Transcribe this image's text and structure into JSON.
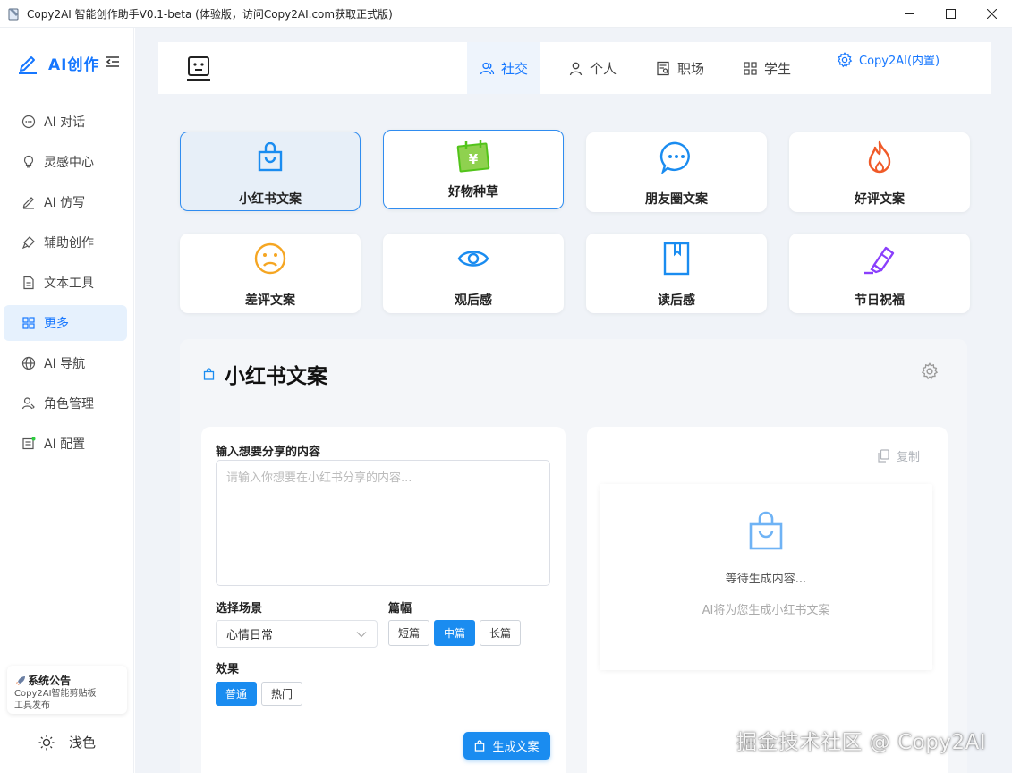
{
  "window": {
    "title": "Copy2AI 智能创作助手V0.1-beta (体验版，访问Copy2AI.com获取正式版)"
  },
  "sidebar": {
    "brand": "AI创作",
    "items": [
      {
        "label": "AI 对话",
        "icon": "chat-icon"
      },
      {
        "label": "灵感中心",
        "icon": "lightbulb-icon"
      },
      {
        "label": "AI 仿写",
        "icon": "pen-icon"
      },
      {
        "label": "辅助创作",
        "icon": "brush-icon"
      },
      {
        "label": "文本工具",
        "icon": "document-icon"
      },
      {
        "label": "更多",
        "icon": "grid-icon",
        "active": true
      },
      {
        "label": "AI 导航",
        "icon": "globe-icon"
      },
      {
        "label": "角色管理",
        "icon": "user-role-icon"
      },
      {
        "label": "AI 配置",
        "icon": "config-icon"
      }
    ],
    "notice": {
      "title": "系统公告",
      "body": "Copy2AI智能剪贴板工具发布"
    },
    "theme_label": "浅色"
  },
  "topnav": {
    "tabs": [
      {
        "label": "社交",
        "icon": "social-icon",
        "active": true
      },
      {
        "label": "个人",
        "icon": "person-icon"
      },
      {
        "label": "职场",
        "icon": "resume-icon"
      },
      {
        "label": "学生",
        "icon": "grid-icon"
      }
    ],
    "settings_label": "Copy2AI(内置)"
  },
  "categories": [
    {
      "label": "小红书文案",
      "icon": "shopping-bag-icon",
      "color": "#1a8cf0",
      "state": "selected"
    },
    {
      "label": "好物种草",
      "icon": "calendar-yen-icon",
      "color": "#52c41a",
      "state": "outlined"
    },
    {
      "label": "朋友圈文案",
      "icon": "chat-bubble-icon",
      "color": "#1a8cf0",
      "state": "normal"
    },
    {
      "label": "好评文案",
      "icon": "flame-icon",
      "color": "#f05a28",
      "state": "normal"
    },
    {
      "label": "差评文案",
      "icon": "sad-face-icon",
      "color": "#f5a623",
      "state": "normal"
    },
    {
      "label": "观后感",
      "icon": "eye-icon",
      "color": "#1a8cf0",
      "state": "normal"
    },
    {
      "label": "读后感",
      "icon": "book-icon",
      "color": "#1a8cf0",
      "state": "normal"
    },
    {
      "label": "节日祝福",
      "icon": "highlighter-icon",
      "color": "#8a3ffc",
      "state": "normal"
    }
  ],
  "panel": {
    "title": "小红书文案",
    "form": {
      "content_label": "输入想要分享的内容",
      "content_placeholder": "请输入你想要在小红书分享的内容...",
      "scene_label": "选择场景",
      "scene_value": "心情日常",
      "length_label": "篇幅",
      "length_options": [
        {
          "label": "短篇",
          "selected": false
        },
        {
          "label": "中篇",
          "selected": true
        },
        {
          "label": "长篇",
          "selected": false
        }
      ],
      "effect_label": "效果",
      "effect_options": [
        {
          "label": "普通",
          "selected": true
        },
        {
          "label": "热门",
          "selected": false
        }
      ],
      "generate_label": "生成文案"
    },
    "output": {
      "copy_label": "复制",
      "waiting": "等待生成内容...",
      "hint": "AI将为您生成小红书文案"
    }
  },
  "watermark": "掘金技术社区 @ Copy2AI",
  "colors": {
    "accent": "#1677ff",
    "primary_button": "#1a8cf0"
  }
}
